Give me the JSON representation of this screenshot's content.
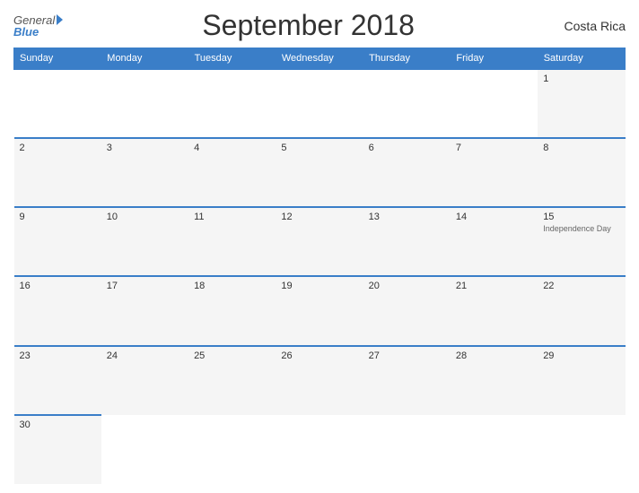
{
  "header": {
    "logo_general": "General",
    "logo_blue": "Blue",
    "title": "September 2018",
    "country": "Costa Rica"
  },
  "weekdays": [
    "Sunday",
    "Monday",
    "Tuesday",
    "Wednesday",
    "Thursday",
    "Friday",
    "Saturday"
  ],
  "weeks": [
    [
      {
        "day": "",
        "empty": true
      },
      {
        "day": "",
        "empty": true
      },
      {
        "day": "",
        "empty": true
      },
      {
        "day": "",
        "empty": true
      },
      {
        "day": "",
        "empty": true
      },
      {
        "day": "",
        "empty": true
      },
      {
        "day": "1",
        "holiday": ""
      }
    ],
    [
      {
        "day": "2",
        "holiday": ""
      },
      {
        "day": "3",
        "holiday": ""
      },
      {
        "day": "4",
        "holiday": ""
      },
      {
        "day": "5",
        "holiday": ""
      },
      {
        "day": "6",
        "holiday": ""
      },
      {
        "day": "7",
        "holiday": ""
      },
      {
        "day": "8",
        "holiday": ""
      }
    ],
    [
      {
        "day": "9",
        "holiday": ""
      },
      {
        "day": "10",
        "holiday": ""
      },
      {
        "day": "11",
        "holiday": ""
      },
      {
        "day": "12",
        "holiday": ""
      },
      {
        "day": "13",
        "holiday": ""
      },
      {
        "day": "14",
        "holiday": ""
      },
      {
        "day": "15",
        "holiday": "Independence Day"
      }
    ],
    [
      {
        "day": "16",
        "holiday": ""
      },
      {
        "day": "17",
        "holiday": ""
      },
      {
        "day": "18",
        "holiday": ""
      },
      {
        "day": "19",
        "holiday": ""
      },
      {
        "day": "20",
        "holiday": ""
      },
      {
        "day": "21",
        "holiday": ""
      },
      {
        "day": "22",
        "holiday": ""
      }
    ],
    [
      {
        "day": "23",
        "holiday": ""
      },
      {
        "day": "24",
        "holiday": ""
      },
      {
        "day": "25",
        "holiday": ""
      },
      {
        "day": "26",
        "holiday": ""
      },
      {
        "day": "27",
        "holiday": ""
      },
      {
        "day": "28",
        "holiday": ""
      },
      {
        "day": "29",
        "holiday": ""
      }
    ],
    [
      {
        "day": "30",
        "holiday": ""
      },
      {
        "day": "",
        "empty": true
      },
      {
        "day": "",
        "empty": true
      },
      {
        "day": "",
        "empty": true
      },
      {
        "day": "",
        "empty": true
      },
      {
        "day": "",
        "empty": true
      },
      {
        "day": "",
        "empty": true
      }
    ]
  ],
  "colors": {
    "header_bg": "#3a7ec8",
    "border": "#3a7ec8",
    "cell_bg": "#f5f5f5"
  }
}
